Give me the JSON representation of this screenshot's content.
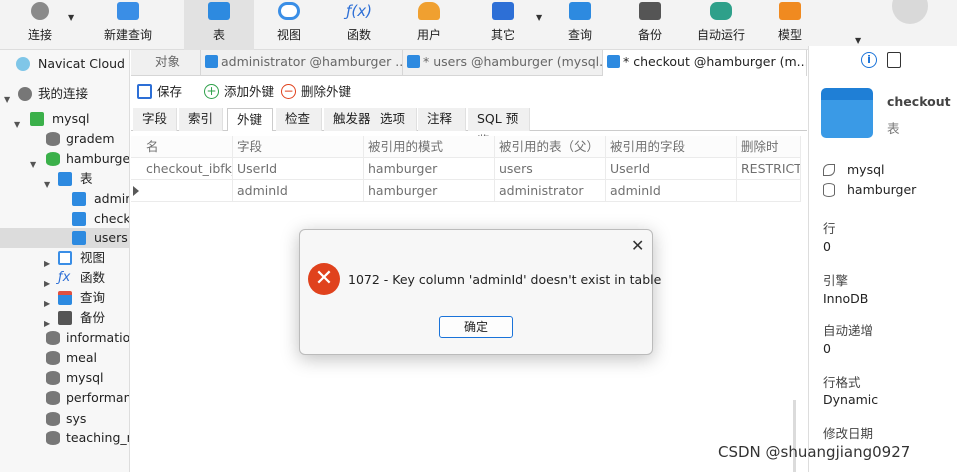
{
  "toolbar": {
    "items": [
      {
        "label": "连接",
        "icon": "plug-icon",
        "color": "#4a4a4a"
      },
      {
        "label": "新建查询",
        "icon": "new-query-icon",
        "color": "#3a8ee6"
      },
      {
        "label": "表",
        "icon": "table-icon",
        "color": "#2d8ae0"
      },
      {
        "label": "视图",
        "icon": "view-icon",
        "color": "#3a8ee6"
      },
      {
        "label": "函数",
        "icon": "function-icon",
        "color": "#2d6fd6"
      },
      {
        "label": "用户",
        "icon": "user-icon",
        "color": "#f0a030"
      },
      {
        "label": "其它",
        "icon": "other-icon",
        "color": "#2d6fd6"
      },
      {
        "label": "查询",
        "icon": "query-icon",
        "color": "#2d8ae0"
      },
      {
        "label": "备份",
        "icon": "backup-icon",
        "color": "#444444"
      },
      {
        "label": "自动运行",
        "icon": "robot-icon",
        "color": "#2ea08a"
      },
      {
        "label": "模型",
        "icon": "model-icon",
        "color": "#f08a20"
      }
    ],
    "active": "表"
  },
  "sidebar": {
    "items": [
      {
        "label": "Navicat Cloud",
        "icon": "cloud-icon"
      },
      {
        "label": "我的连接",
        "icon": "connection-icon"
      },
      {
        "label": "mysql",
        "icon": "mysql-icon"
      },
      {
        "label": "gradem",
        "icon": "database-icon"
      },
      {
        "label": "hamburger",
        "icon": "database-icon"
      },
      {
        "label": "表",
        "icon": "table-icon"
      },
      {
        "label": "administrator",
        "icon": "table-icon"
      },
      {
        "label": "checkout",
        "icon": "table-icon"
      },
      {
        "label": "users",
        "icon": "table-icon"
      },
      {
        "label": "视图",
        "icon": "view-icon"
      },
      {
        "label": "函数",
        "icon": "function-icon"
      },
      {
        "label": "查询",
        "icon": "query-icon"
      },
      {
        "label": "备份",
        "icon": "backup-icon"
      },
      {
        "label": "information_schema",
        "icon": "database-icon"
      },
      {
        "label": "meal",
        "icon": "database-icon"
      },
      {
        "label": "mysql",
        "icon": "database-icon"
      },
      {
        "label": "performance_schema",
        "icon": "database-icon"
      },
      {
        "label": "sys",
        "icon": "database-icon"
      },
      {
        "label": "teaching_management",
        "icon": "database-icon"
      }
    ]
  },
  "tabs": [
    {
      "label": "对象"
    },
    {
      "label": "administrator @hamburger ..."
    },
    {
      "label": "* users @hamburger (mysql..."
    },
    {
      "label": "* checkout @hamburger (m..."
    }
  ],
  "actions": {
    "save": "保存",
    "add_fk": "添加外键",
    "delete_fk": "删除外键"
  },
  "subtabs": [
    "字段",
    "索引",
    "外键",
    "检查",
    "触发器",
    "选项",
    "注释",
    "SQL 预览"
  ],
  "fk_table": {
    "columns": [
      "名",
      "字段",
      "被引用的模式",
      "被引用的表（父）",
      "被引用的字段",
      "删除时"
    ],
    "rows": [
      [
        "checkout_ibfk_1",
        "UserId",
        "hamburger",
        "users",
        "UserId",
        "RESTRICT"
      ],
      [
        "",
        "adminId",
        "hamburger",
        "administrator",
        "adminId",
        ""
      ]
    ]
  },
  "info_panel": {
    "name": "checkout",
    "type": "表",
    "connection": "mysql",
    "database": "hamburger",
    "fields": [
      {
        "label": "行",
        "value": "0"
      },
      {
        "label": "引擎",
        "value": "InnoDB"
      },
      {
        "label": "自动递增",
        "value": "0"
      },
      {
        "label": "行格式",
        "value": "Dynamic"
      },
      {
        "label": "修改日期",
        "value": ""
      }
    ]
  },
  "dialog": {
    "message": "1072 - Key column 'adminId' doesn't exist in table",
    "ok_label": "确定",
    "close_glyph": "✕",
    "error_glyph": "✕"
  },
  "watermark": "CSDN @shuangjiang0927"
}
